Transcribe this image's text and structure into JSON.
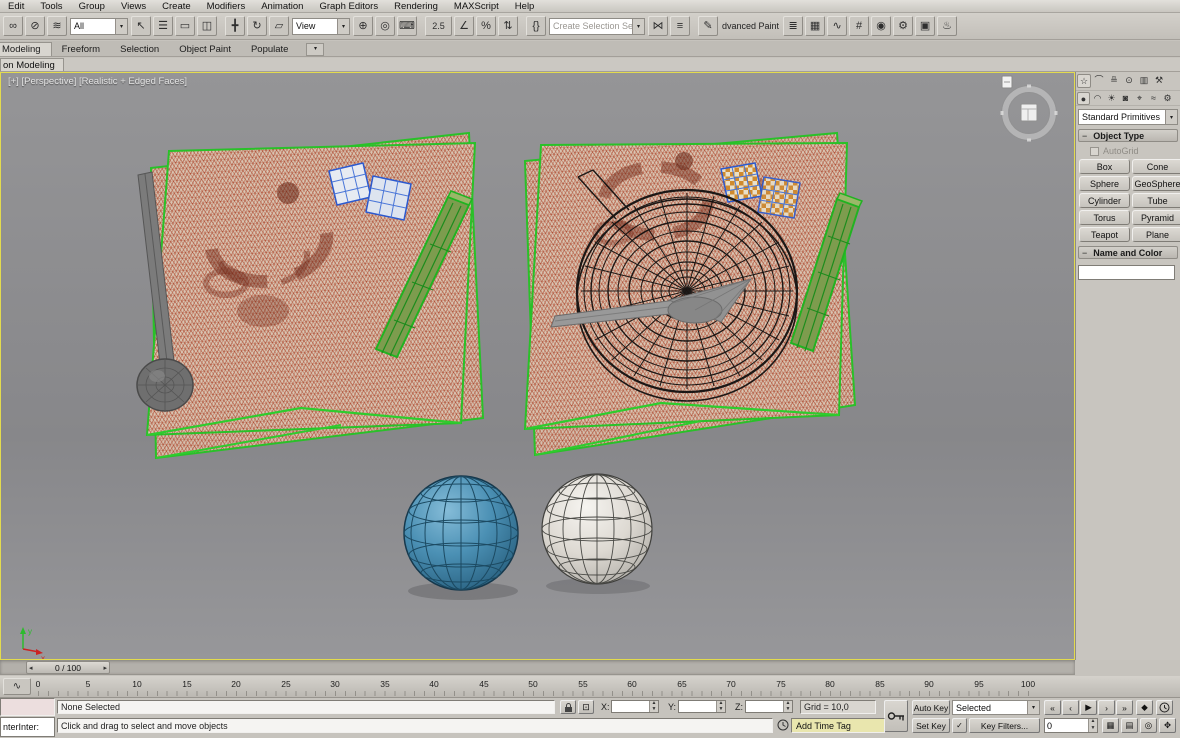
{
  "menu": {
    "items": [
      "Edit",
      "Tools",
      "Group",
      "Views",
      "Create",
      "Modifiers",
      "Animation",
      "Graph Editors",
      "Rendering",
      "MAXScript",
      "Help"
    ]
  },
  "toolbar": {
    "selection_filter_value": "All",
    "coord_system_value": "View",
    "named_selection_value": "Create Selection Se",
    "snap_value": "2.5",
    "advanced_paint_label": "dvanced Paint",
    "icons": {
      "select_and_link": "∞",
      "unlink_selection": "⊘",
      "bind_space_warp": "≋",
      "select_object": "↖",
      "select_by_name": "☰",
      "selection_region": "▭",
      "window_crossing": "◫",
      "select_move": "╋",
      "select_rotate": "↻",
      "select_scale": "▱",
      "pivot_center": "⊕",
      "select_manipulate": "◎",
      "kbd_override": "⌨",
      "angle_snap": "∠",
      "percent_snap": "%",
      "spinner_snap": "⇅",
      "edit_selection_sets": "{}",
      "mirror": "⋈",
      "align": "≡",
      "paint": "✎",
      "layer_manager": "≣",
      "graphite": "▦",
      "curve_editor": "∿",
      "schematic_view": "#",
      "material_editor": "◉",
      "render_setup": "⚙",
      "rendered_frame": "▣",
      "render_production": "♨"
    }
  },
  "ribbon": {
    "tabs": [
      "Modeling",
      "Freeform",
      "Selection",
      "Object Paint",
      "Populate"
    ],
    "subtab": "on Modeling"
  },
  "viewport": {
    "label": "[+] [Perspective] [Realistic + Edged Faces]",
    "axis_x": "x",
    "axis_y": "y"
  },
  "command_panel": {
    "dropdown_value": "Standard Primitives",
    "object_type_title": "Object Type",
    "autogrid_label": "AutoGrid",
    "buttons": [
      "Box",
      "Cone",
      "Sphere",
      "GeoSphere",
      "Cylinder",
      "Tube",
      "Torus",
      "Pyramid",
      "Teapot",
      "Plane"
    ],
    "name_color_title": "Name and Color",
    "name_value": ""
  },
  "time_slider": {
    "value": "0 / 100"
  },
  "track_bar": {
    "ticks": [
      "0",
      "5",
      "10",
      "15",
      "20",
      "25",
      "30",
      "35",
      "40",
      "45",
      "50",
      "55",
      "60",
      "65",
      "70",
      "75",
      "80",
      "85",
      "90",
      "95",
      "100"
    ]
  },
  "status_bar": {
    "listener_text": "nterInter:",
    "selection_status": "None Selected",
    "prompt": "Click and drag to select and move objects",
    "x_label": "X:",
    "y_label": "Y:",
    "z_label": "Z:",
    "x_value": "",
    "y_value": "",
    "z_value": "",
    "grid_label": "Grid = 10,0",
    "add_time_tag_label": "Add Time Tag"
  },
  "animation": {
    "auto_key_label": "Auto Key",
    "set_key_label": "Set Key",
    "selection_set_value": "Selected",
    "key_filters_label": "Key Filters...",
    "frame_value": "0"
  }
}
